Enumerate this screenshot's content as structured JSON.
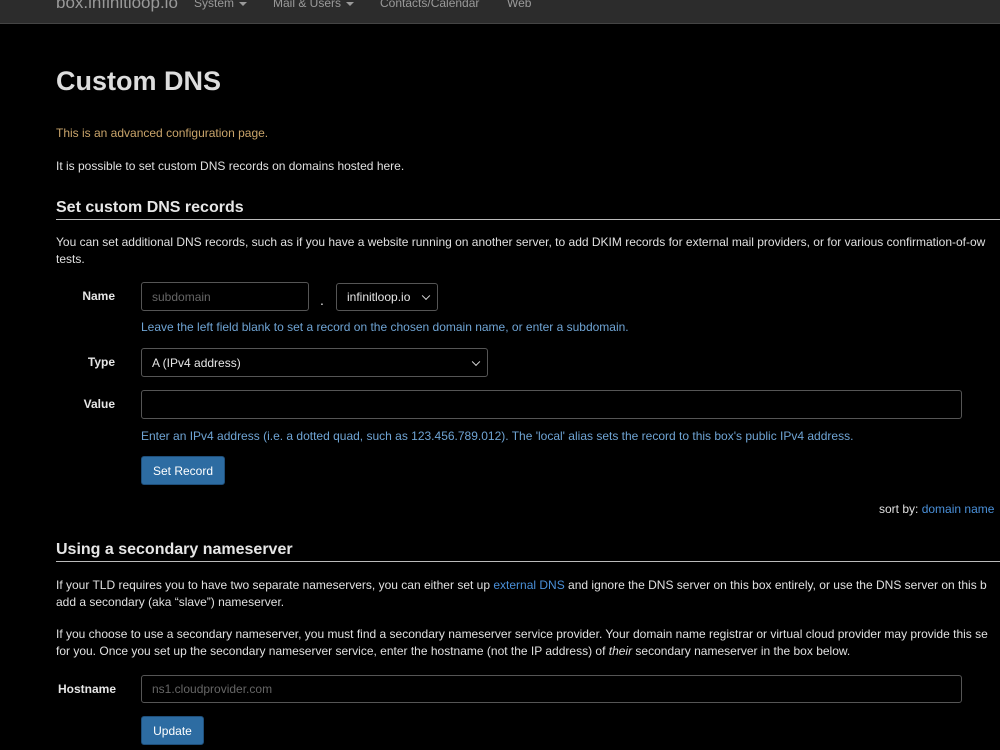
{
  "navbar": {
    "brand": "box.infinitloop.io",
    "items": [
      {
        "label": "System",
        "dropdown": true
      },
      {
        "label": "Mail & Users",
        "dropdown": true
      },
      {
        "label": "Contacts/Calendar",
        "dropdown": false
      },
      {
        "label": "Web",
        "dropdown": false
      }
    ]
  },
  "page": {
    "title": "Custom DNS",
    "warning": "This is an advanced configuration page.",
    "intro": "It is possible to set custom DNS records on domains hosted here."
  },
  "custom_records": {
    "heading": "Set custom DNS records",
    "desc_line1": "You can set additional DNS records, such as if you have a website running on another server, to add DKIM records for external mail providers, or for various confirmation-of-ow",
    "desc_line2": "tests.",
    "name_label": "Name",
    "subdomain_placeholder": "subdomain",
    "dot": ".",
    "domain_selected": "infinitloop.io",
    "name_help": "Leave the left field blank to set a record on the chosen domain name, or enter a subdomain.",
    "type_label": "Type",
    "type_selected": "A (IPv4 address)",
    "value_label": "Value",
    "value": "",
    "value_help": "Enter an IPv4 address (i.e. a dotted quad, such as 123.456.789.012). The 'local' alias sets the record to this box's public IPv4 address.",
    "submit_label": "Set Record",
    "sort_by_label": "sort by:",
    "sort_by_value": "domain name"
  },
  "secondary_ns": {
    "heading": "Using a secondary nameserver",
    "p1_before_link": "If your TLD requires you to have two separate nameservers, you can either set up ",
    "p1_link": "external DNS",
    "p1_after_link": " and ignore the DNS server on this box entirely, or use the DNS server on this b",
    "p1_line2": "add a secondary (aka “slave”) nameserver.",
    "p2_line1": "If you choose to use a secondary nameserver, you must find a secondary nameserver service provider. Your domain name registrar or virtual cloud provider may provide this se",
    "p2_line2_before": "for you. Once you set up the secondary nameserver service, enter the hostname (not the IP address) of ",
    "p2_line2_em": "their",
    "p2_line2_after": " secondary nameserver in the box below.",
    "hostname_label": "Hostname",
    "hostname_placeholder": "ns1.cloudprovider.com",
    "update_label": "Update"
  }
}
